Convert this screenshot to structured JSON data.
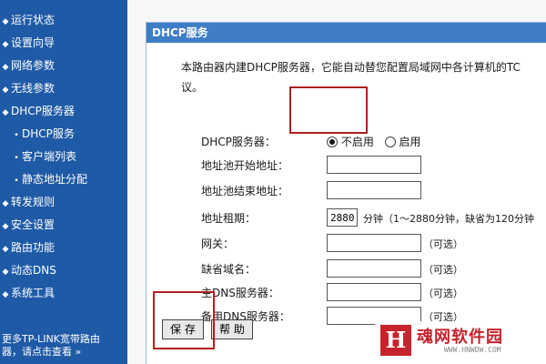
{
  "sidebar": {
    "items": [
      {
        "label": "运行状态",
        "sub": false
      },
      {
        "label": "设置向导",
        "sub": false
      },
      {
        "label": "网络参数",
        "sub": false
      },
      {
        "label": "无线参数",
        "sub": false
      },
      {
        "label": "DHCP服务器",
        "sub": false
      },
      {
        "label": "DHCP服务",
        "sub": true
      },
      {
        "label": "客户端列表",
        "sub": true
      },
      {
        "label": "静态地址分配",
        "sub": true
      },
      {
        "label": "转发规则",
        "sub": false
      },
      {
        "label": "安全设置",
        "sub": false
      },
      {
        "label": "路由功能",
        "sub": false
      },
      {
        "label": "动态DNS",
        "sub": false
      },
      {
        "label": "系统工具",
        "sub": false
      }
    ],
    "footer_line1": "更多TP-LINK宽带路由",
    "footer_line2": "器，请点击查看 »"
  },
  "panel": {
    "title": "DHCP服务",
    "intro_line1": "本路由器内建DHCP服务器，它能自动替您配置局域网中各计算机的TC",
    "intro_line2": "议。"
  },
  "form": {
    "dhcp_server_label": "DHCP服务器：",
    "option_disable": "不启用",
    "option_enable": "启用",
    "pool_start_label": "地址池开始地址：",
    "pool_start_value": "",
    "pool_end_label": "地址池结束地址：",
    "pool_end_value": "",
    "lease_label": "地址租期：",
    "lease_value": "2880",
    "lease_hint": "分钟（1～2880分钟，缺省为120分钟",
    "gateway_label": "网关：",
    "gateway_value": "",
    "domain_label": "缺省域名：",
    "domain_value": "",
    "primary_dns_label": "主DNS服务器：",
    "primary_dns_value": "",
    "secondary_dns_label": "备用DNS服务器：",
    "secondary_dns_value": "",
    "optional_text": "（可选）"
  },
  "buttons": {
    "save": "保 存",
    "help": "帮 助"
  },
  "watermark": {
    "mark": "H",
    "title": "魂网软件园",
    "url": "WWW.HNWDW.COM"
  },
  "colors": {
    "sidebar_bg": "#1f5aa6",
    "header_bg": "#3f7dc7",
    "highlight": "#b02020"
  }
}
